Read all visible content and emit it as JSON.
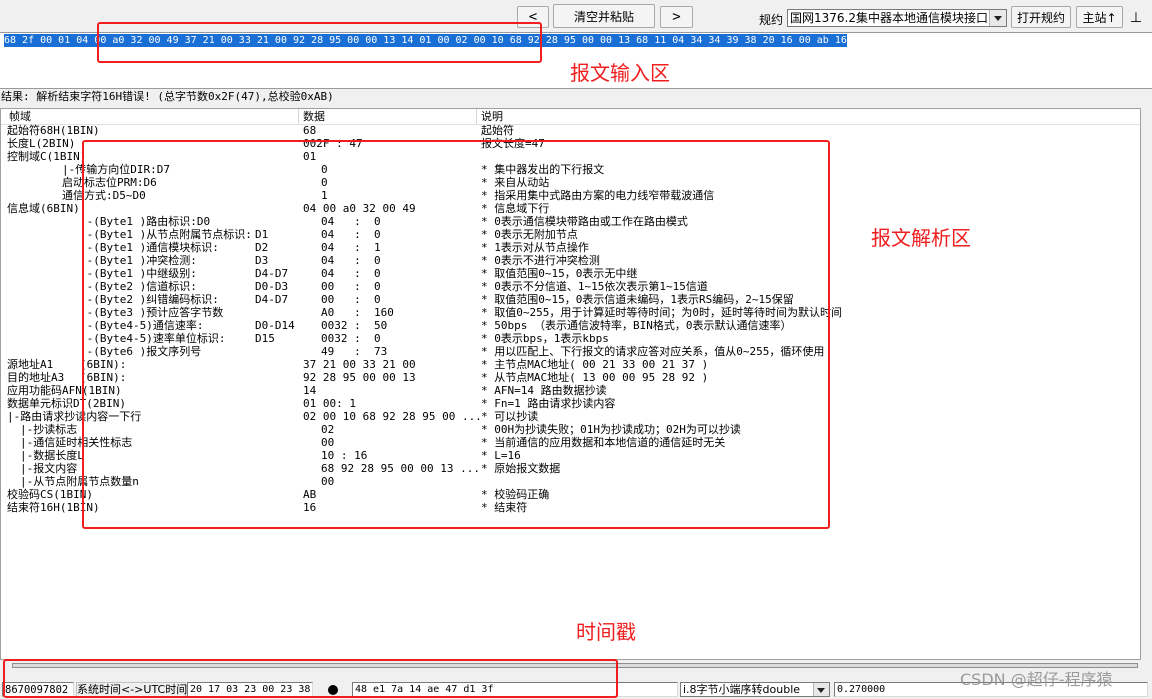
{
  "toolbar": {
    "prev_label": "<",
    "clear_paste_label": "清空并粘贴",
    "next_label": ">",
    "protocol_label": "规约",
    "protocol_selected": "国网1376.2集中器本地通信模块接口协",
    "open_protocol_label": "打开规约",
    "master_label": "主站↑",
    "pin_label": "⊥"
  },
  "input": {
    "hex": "68 2f 00 01 04 00 a0 32 00 49 37 21 00 33 21 00 92 28 95 00 00 13 14 01 00 02 00 10 68 92 28 95 00 00 13 68 11 04 34 34 39 38 20 16 00 ab 16"
  },
  "result": "结果: 解析结束字符16H错误! (总字节数0x2F(47),总校验0xAB)",
  "table": {
    "columns": {
      "field": "帧域",
      "data": "数据",
      "desc": "说明"
    },
    "rows": [
      {
        "depth": 0,
        "field": "起始符68H(1BIN)",
        "data": "68",
        "desc": "起始符"
      },
      {
        "depth": 0,
        "field": "长度L(2BIN)",
        "data": "002F : 47",
        "desc": "报文长度=47"
      },
      {
        "depth": 0,
        "field": "控制域C(1BIN)",
        "data": "01"
      },
      {
        "depth": 2,
        "field": "|-传输方向位DIR:D7",
        "data": "0",
        "desc": "* 集中器发出的下行报文"
      },
      {
        "depth": 2,
        "field": "启动标志位PRM:D6",
        "data": "0",
        "desc": "* 来自从动站"
      },
      {
        "depth": 2,
        "field": "通信方式:D5~D0",
        "data": "1",
        "desc": "* 指采用集中式路由方案的电力线窄带载波通信"
      },
      {
        "depth": 0,
        "field": "信息域(6BIN)",
        "data": "04 00 a0 32 00 49",
        "desc": "* 信息域下行"
      },
      {
        "depth": 3,
        "field": "|-(Byte1 )路由标识:D0",
        "data": "04   :  0",
        "desc": "* 0表示通信模块带路由或工作在路由模式"
      },
      {
        "depth": 3,
        "field": "|-(Byte1 )从节点附属节点标识:",
        "bits": "D1",
        "data": "04   :  0",
        "desc": "* 0表示无附加节点"
      },
      {
        "depth": 3,
        "field": "|-(Byte1 )通信模块标识:",
        "bits": "D2",
        "data": "04   :  1",
        "desc": "* 1表示对从节点操作"
      },
      {
        "depth": 3,
        "field": "|-(Byte1 )冲突检测:",
        "bits": "D3",
        "data": "04   :  0",
        "desc": "* 0表示不进行冲突检测"
      },
      {
        "depth": 3,
        "field": "|-(Byte1 )中继级别:",
        "bits": "D4-D7",
        "data": "04   :  0",
        "desc": "* 取值范围0~15，0表示无中继"
      },
      {
        "depth": 3,
        "field": "|-(Byte2 )信道标识:",
        "bits": "D0-D3",
        "data": "00   :  0",
        "desc": "* 0表示不分信道、1~15依次表示第1~15信道"
      },
      {
        "depth": 3,
        "field": "|-(Byte2 )纠错编码标识:",
        "bits": "D4-D7",
        "data": "00   :  0",
        "desc": "* 取值范围0~15，0表示信道未编码，1表示RS编码，2~15保留"
      },
      {
        "depth": 3,
        "field": "|-(Byte3 )预计应答字节数",
        "data": "A0   :  160",
        "desc": "* 取值0~255，用于计算延时等待时间；为0时，延时等待时间为默认时间"
      },
      {
        "depth": 3,
        "field": "|-(Byte4-5)通信速率:",
        "bits": "D0-D14",
        "data": "0032 :  50",
        "desc": "* 50bps （表示通信波特率，BIN格式，0表示默认通信速率）"
      },
      {
        "depth": 3,
        "field": "|-(Byte4-5)速率单位标识:",
        "bits": "D15",
        "data": "0032 :  0",
        "desc": "* 0表示bps，1表示kbps"
      },
      {
        "depth": 3,
        "field": "|-(Byte6 )报文序列号",
        "data": "49   :  73",
        "desc": "* 用以匹配上、下行报文的请求应答对应关系，值从0~255，循环使用"
      },
      {
        "depth": 0,
        "field": "源地址A1",
        "unit": "(6BIN):",
        "data": "37 21 00 33 21 00",
        "desc": "* 主节点MAC地址( 00 21 33 00 21 37 )"
      },
      {
        "depth": 0,
        "field": "目的地址A3",
        "unit": "(6BIN):",
        "data": "92 28 95 00 00 13",
        "desc": "* 从节点MAC地址( 13 00 00 95 28 92 )"
      },
      {
        "depth": 0,
        "field": "应用功能码AFN(1BIN)",
        "data": "14",
        "desc": "* AFN=14 路由数据抄读"
      },
      {
        "depth": 0,
        "field": "数据单元标识DT(2BIN)",
        "data": "01 00: 1",
        "desc": "* Fn=1 路由请求抄读内容"
      },
      {
        "depth": 0,
        "field": "|-路由请求抄读内容一下行",
        "data": "02 00 10 68 92 28 95 00 ...",
        "desc": "* 可以抄读"
      },
      {
        "depth": 1,
        "field": "|-抄读标志",
        "data": "02",
        "desc": "* 00H为抄读失败；01H为抄读成功；02H为可以抄读"
      },
      {
        "depth": 1,
        "field": "|-通信延时相关性标志",
        "data": "00",
        "desc": "* 当前通信的应用数据和本地信道的通信延时无关"
      },
      {
        "depth": 1,
        "field": "|-数据长度L",
        "data": "10 : 16",
        "desc": "* L=16"
      },
      {
        "depth": 1,
        "field": "|-报文内容",
        "data": "68 92 28 95 00 00 13 ...",
        "desc": "* 原始报文数据"
      },
      {
        "depth": 1,
        "field": "|-从节点附属节点数量n",
        "data": "00"
      },
      {
        "depth": 0,
        "field": "校验码CS(1BIN)",
        "data": "AB",
        "desc": "* 校验码正确"
      },
      {
        "depth": 0,
        "field": "结束符16H(1BIN)",
        "data": "16",
        "desc": "* 结束符"
      }
    ]
  },
  "statusbar": {
    "counter": "8670097802",
    "time_convert_label": "系统时间<->UTC时间",
    "time_value": "20 17 03 23 00 23 38",
    "hex_value": "48 e1 7a 14 ae 47 d1 3f",
    "convert_mode": "i.8字节小端序转double",
    "result_value": "0.270000"
  },
  "annotations": {
    "input_area": "报文输入区",
    "parse_area": "报文解析区",
    "timestamp": "时间戳"
  },
  "watermark": "CSDN @超仔-程序猿",
  "icons": {
    "dropdown": "chevron-down-icon",
    "toggle": "dot-icon"
  },
  "colors": {
    "selection": "#1a6fd6",
    "annotation": "#f01e1e",
    "watermark": "#8c8c8c"
  }
}
